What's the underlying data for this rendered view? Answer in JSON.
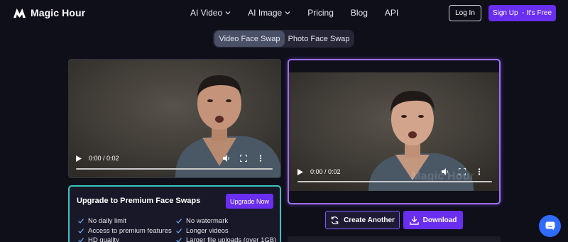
{
  "brand": {
    "name": "Magic Hour"
  },
  "nav": {
    "links": [
      {
        "label": "AI Video",
        "dropdown": true
      },
      {
        "label": "AI Image",
        "dropdown": true
      },
      {
        "label": "Pricing",
        "dropdown": false
      },
      {
        "label": "Blog",
        "dropdown": false
      },
      {
        "label": "API",
        "dropdown": false
      }
    ],
    "login_label": "Log In",
    "signup_label": "Sign Up  - It's Free"
  },
  "tabs": [
    {
      "label": "Video Face Swap",
      "active": true
    },
    {
      "label": "Photo Face Swap",
      "active": false
    }
  ],
  "source_video": {
    "time": "0:00 / 0:02",
    "progress": 0
  },
  "result_video": {
    "time": "0:00 / 0:02",
    "progress": 0,
    "watermark": "Magic Hour"
  },
  "upgrade": {
    "title": "Upgrade to Premium Face Swaps",
    "button_label": "Upgrade Now",
    "features_left": [
      "No daily limit",
      "Access to premium features",
      "HD quality"
    ],
    "features_right": [
      "No watermark",
      "Longer videos",
      "Larger file uploads (over 1GB)"
    ]
  },
  "actions": {
    "create_label": "Create Another",
    "download_label": "Download"
  },
  "colors": {
    "accent": "#6a2ef0",
    "upgrade_border": "#38c4c0",
    "result_border": "#a070ff",
    "chat": "#2f6bff"
  },
  "icons": [
    "logo-icon",
    "chevron-down-icon",
    "play-icon",
    "volume-icon",
    "fullscreen-icon",
    "more-vertical-icon",
    "check-icon",
    "refresh-icon",
    "download-icon",
    "chat-icon"
  ]
}
